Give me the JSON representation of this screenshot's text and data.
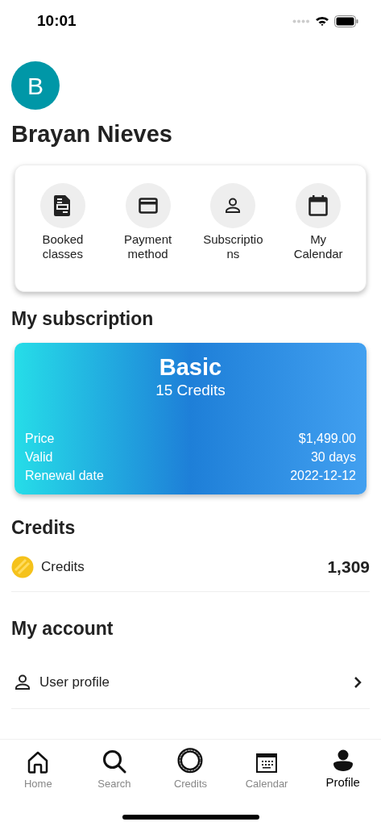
{
  "status_bar": {
    "time": "10:01"
  },
  "profile": {
    "initial": "B",
    "name": "Brayan Nieves"
  },
  "quick_actions": [
    {
      "kind": "document",
      "label": "Booked classes"
    },
    {
      "kind": "card",
      "label": "Payment method"
    },
    {
      "kind": "person",
      "label": "Subscriptions"
    },
    {
      "kind": "calendar",
      "label": "My Calendar"
    }
  ],
  "subscription": {
    "heading": "My subscription",
    "plan": "Basic",
    "credits": "15 Credits",
    "details": [
      {
        "label": "Price",
        "value": "$1,499.00"
      },
      {
        "label": "Valid",
        "value": "30 days"
      },
      {
        "label": "Renewal date",
        "value": "2022-12-12"
      }
    ]
  },
  "credits": {
    "heading": "Credits",
    "label": "Credits",
    "value": "1,309"
  },
  "account": {
    "heading": "My account",
    "items": [
      {
        "kind": "person",
        "label": "User profile"
      }
    ]
  },
  "tab_bar": [
    {
      "kind": "home",
      "label": "Home",
      "selected": false
    },
    {
      "kind": "search",
      "label": "Search",
      "selected": false
    },
    {
      "kind": "coin",
      "label": "Credits",
      "selected": false
    },
    {
      "kind": "calendar",
      "label": "Calendar",
      "selected": false
    },
    {
      "kind": "profile",
      "label": "Profile",
      "selected": true
    }
  ]
}
